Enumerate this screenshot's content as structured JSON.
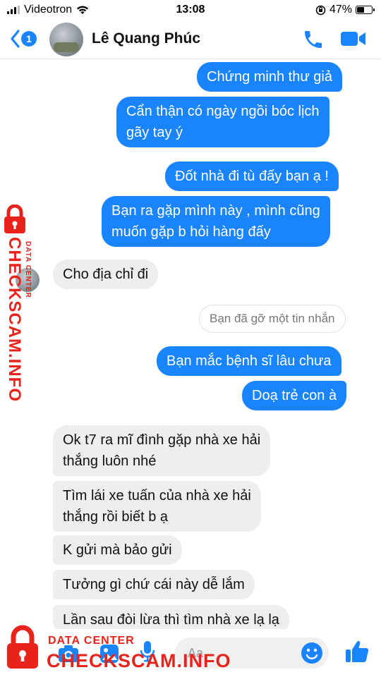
{
  "status_bar": {
    "carrier": "Videotron",
    "time": "13:08",
    "battery": "47%"
  },
  "header": {
    "back_count": "1",
    "contact_name": "Lê Quang Phúc"
  },
  "messages": [
    {
      "side": "out",
      "text": "Chứng minh thư giả"
    },
    {
      "side": "out",
      "lines": [
        "Cẩn thận có ngày ngồi bóc lịch",
        "gãy tay ý"
      ]
    },
    {
      "side": "out",
      "text": "Đốt nhà đi tù đấy bạn ạ !"
    },
    {
      "side": "out",
      "lines": [
        "Bạn ra gặp mình này , mình cũng",
        "muốn gặp b hỏi hàng đấy"
      ]
    },
    {
      "side": "in",
      "text": "Cho địa chỉ đi"
    },
    {
      "side": "system",
      "text": "Bạn đã gỡ một tin nhắn"
    },
    {
      "side": "out",
      "text": "Bạn mắc bệnh sĩ lâu chưa"
    },
    {
      "side": "out",
      "text": "Doạ trẻ con à"
    },
    {
      "side": "in",
      "lines": [
        "Ok t7 ra mĩ đình gặp nhà xe hải",
        "thắng luôn nhé"
      ]
    },
    {
      "side": "in",
      "lines": [
        "Tìm lái xe tuấn của nhà xe hải",
        "thắng rồi biết b ạ"
      ]
    },
    {
      "side": "in",
      "text": "K gửi mà bảo gửi"
    },
    {
      "side": "in",
      "text": "Tưởng gì chứ cái này dễ lắm"
    },
    {
      "side": "in",
      "text": "Lần sau đòi lừa thì tìm nhà xe lạ lạ"
    }
  ],
  "composer": {
    "placeholder": "Aa"
  },
  "watermark": {
    "brand": "CHECKSCAM.INFO",
    "sub": "DATA CENTER"
  },
  "colors": {
    "messenger_blue": "#1a84ff",
    "incoming_bubble": "#eeeeee",
    "watermark_red": "#e8231c"
  },
  "icons": [
    "wifi-icon",
    "back-chevron-icon",
    "phone-icon",
    "video-camera-icon",
    "camera-icon",
    "gallery-icon",
    "microphone-icon",
    "emoji-icon",
    "thumbs-up-icon",
    "lock-icon"
  ]
}
